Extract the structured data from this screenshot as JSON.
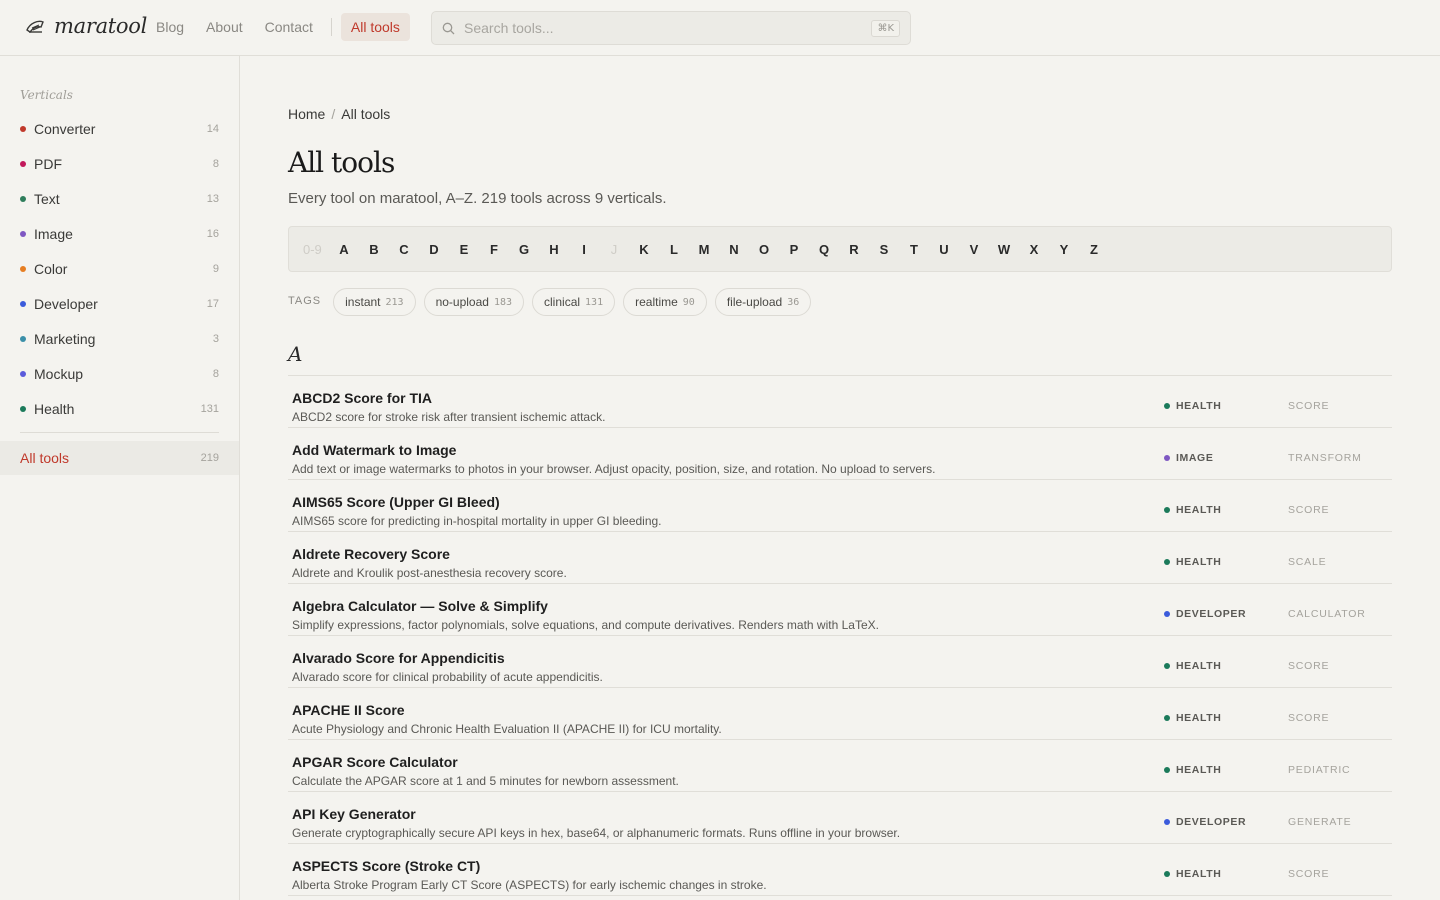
{
  "brand": {
    "name": "maratool"
  },
  "nav": {
    "blog": "Blog",
    "about": "About",
    "contact": "Contact",
    "all_tools": "All tools"
  },
  "search": {
    "placeholder": "Search tools...",
    "shortcut": "⌘K"
  },
  "sidebar": {
    "heading": "Verticals",
    "items": [
      {
        "label": "Converter",
        "count": "14",
        "color": "#c0392b"
      },
      {
        "label": "PDF",
        "count": "8",
        "color": "#c2185b"
      },
      {
        "label": "Text",
        "count": "13",
        "color": "#2e7d5b"
      },
      {
        "label": "Image",
        "count": "16",
        "color": "#7e57c2"
      },
      {
        "label": "Color",
        "count": "9",
        "color": "#e67e22"
      },
      {
        "label": "Developer",
        "count": "17",
        "color": "#3b5bdb"
      },
      {
        "label": "Marketing",
        "count": "3",
        "color": "#3a8fa8"
      },
      {
        "label": "Mockup",
        "count": "8",
        "color": "#5b5bdb"
      },
      {
        "label": "Health",
        "count": "131",
        "color": "#1b7a5a"
      }
    ],
    "all": {
      "label": "All tools",
      "count": "219"
    }
  },
  "breadcrumb": {
    "home": "Home",
    "separator": "/",
    "current": "All tools"
  },
  "page": {
    "title": "All tools",
    "subtitle": "Every tool on maratool, A–Z. 219 tools across 9 verticals."
  },
  "letters": [
    {
      "label": "0-9",
      "enabled": false
    },
    {
      "label": "A",
      "enabled": true
    },
    {
      "label": "B",
      "enabled": true
    },
    {
      "label": "C",
      "enabled": true
    },
    {
      "label": "D",
      "enabled": true
    },
    {
      "label": "E",
      "enabled": true
    },
    {
      "label": "F",
      "enabled": true
    },
    {
      "label": "G",
      "enabled": true
    },
    {
      "label": "H",
      "enabled": true
    },
    {
      "label": "I",
      "enabled": true
    },
    {
      "label": "J",
      "enabled": false
    },
    {
      "label": "K",
      "enabled": true
    },
    {
      "label": "L",
      "enabled": true
    },
    {
      "label": "M",
      "enabled": true
    },
    {
      "label": "N",
      "enabled": true
    },
    {
      "label": "O",
      "enabled": true
    },
    {
      "label": "P",
      "enabled": true
    },
    {
      "label": "Q",
      "enabled": true
    },
    {
      "label": "R",
      "enabled": true
    },
    {
      "label": "S",
      "enabled": true
    },
    {
      "label": "T",
      "enabled": true
    },
    {
      "label": "U",
      "enabled": true
    },
    {
      "label": "V",
      "enabled": true
    },
    {
      "label": "W",
      "enabled": true
    },
    {
      "label": "X",
      "enabled": true
    },
    {
      "label": "Y",
      "enabled": true
    },
    {
      "label": "Z",
      "enabled": true
    }
  ],
  "tags": {
    "label": "TAGS",
    "items": [
      {
        "name": "instant",
        "count": "213"
      },
      {
        "name": "no-upload",
        "count": "183"
      },
      {
        "name": "clinical",
        "count": "131"
      },
      {
        "name": "realtime",
        "count": "90"
      },
      {
        "name": "file-upload",
        "count": "36"
      }
    ]
  },
  "section": {
    "letter": "A"
  },
  "tools": [
    {
      "title": "ABCD2 Score for TIA",
      "desc": "ABCD2 score for stroke risk after transient ischemic attack.",
      "vertical": "HEALTH",
      "color": "#1b7a5a",
      "kind": "SCORE"
    },
    {
      "title": "Add Watermark to Image",
      "desc": "Add text or image watermarks to photos in your browser. Adjust opacity, position, size, and rotation. No upload to servers.",
      "vertical": "IMAGE",
      "color": "#7e57c2",
      "kind": "TRANSFORM"
    },
    {
      "title": "AIMS65 Score (Upper GI Bleed)",
      "desc": "AIMS65 score for predicting in-hospital mortality in upper GI bleeding.",
      "vertical": "HEALTH",
      "color": "#1b7a5a",
      "kind": "SCORE"
    },
    {
      "title": "Aldrete Recovery Score",
      "desc": "Aldrete and Kroulik post-anesthesia recovery score.",
      "vertical": "HEALTH",
      "color": "#1b7a5a",
      "kind": "SCALE"
    },
    {
      "title": "Algebra Calculator — Solve & Simplify",
      "desc": "Simplify expressions, factor polynomials, solve equations, and compute derivatives. Renders math with LaTeX.",
      "vertical": "DEVELOPER",
      "color": "#3b5bdb",
      "kind": "CALCULATOR"
    },
    {
      "title": "Alvarado Score for Appendicitis",
      "desc": "Alvarado score for clinical probability of acute appendicitis.",
      "vertical": "HEALTH",
      "color": "#1b7a5a",
      "kind": "SCORE"
    },
    {
      "title": "APACHE II Score",
      "desc": "Acute Physiology and Chronic Health Evaluation II (APACHE II) for ICU mortality.",
      "vertical": "HEALTH",
      "color": "#1b7a5a",
      "kind": "SCORE"
    },
    {
      "title": "APGAR Score Calculator",
      "desc": "Calculate the APGAR score at 1 and 5 minutes for newborn assessment.",
      "vertical": "HEALTH",
      "color": "#1b7a5a",
      "kind": "PEDIATRIC"
    },
    {
      "title": "API Key Generator",
      "desc": "Generate cryptographically secure API keys in hex, base64, or alphanumeric formats. Runs offline in your browser.",
      "vertical": "DEVELOPER",
      "color": "#3b5bdb",
      "kind": "GENERATE"
    },
    {
      "title": "ASPECTS Score (Stroke CT)",
      "desc": "Alberta Stroke Program Early CT Score (ASPECTS) for early ischemic changes in stroke.",
      "vertical": "HEALTH",
      "color": "#1b7a5a",
      "kind": "SCORE"
    }
  ]
}
